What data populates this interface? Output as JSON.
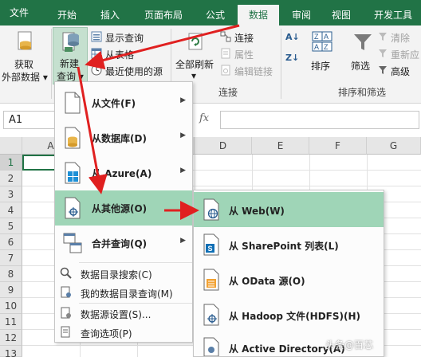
{
  "tabs": [
    {
      "label": "文件",
      "active": false
    },
    {
      "label": "开始",
      "active": false
    },
    {
      "label": "插入",
      "active": false
    },
    {
      "label": "页面布局",
      "active": false
    },
    {
      "label": "公式",
      "active": false
    },
    {
      "label": "数据",
      "active": true
    },
    {
      "label": "审阅",
      "active": false
    },
    {
      "label": "视图",
      "active": false
    },
    {
      "label": "开发工具",
      "active": false
    }
  ],
  "ribbon": {
    "get_external_data": [
      "获取",
      "外部数据 ▾"
    ],
    "new_query": [
      "新建",
      "查询 ▾"
    ],
    "show_queries": "显示查询",
    "from_table": "从表格",
    "recent_sources": "最近使用的源",
    "refresh_all": "全部刷新",
    "connections": "连接",
    "properties": "属性",
    "edit_links": "编辑链接",
    "group_connections": "连接",
    "sort": "排序",
    "filter": "筛选",
    "clear": "清除",
    "reapply": "重新应",
    "advanced": "高级",
    "group_sort_filter": "排序和筛选"
  },
  "formula_bar": {
    "name_box": "A1",
    "fx": "fx"
  },
  "grid": {
    "columns": [
      "A",
      "B",
      "C",
      "D",
      "E",
      "F",
      "G"
    ],
    "rows": [
      "1",
      "2",
      "3",
      "4",
      "5",
      "6",
      "7",
      "8",
      "9",
      "10",
      "11",
      "12",
      "13"
    ]
  },
  "menu_new_query": {
    "items": [
      {
        "label": "从文件(F)",
        "icon": "file-icon"
      },
      {
        "label": "从数据库(D)",
        "icon": "database-icon"
      },
      {
        "label": "从 Azure(A)",
        "icon": "azure-icon"
      },
      {
        "label": "从其他源(O)",
        "icon": "other-source-icon"
      },
      {
        "label": "合并查询(Q)",
        "icon": "combine-icon"
      }
    ],
    "small_items": [
      {
        "label": "数据目录搜索(C)",
        "icon": "catalog-search-icon"
      },
      {
        "label": "我的数据目录查询(M)",
        "icon": "my-catalog-icon"
      },
      {
        "label": "数据源设置(S)...",
        "icon": "source-settings-icon"
      },
      {
        "label": "查询选项(P)",
        "icon": "query-options-icon"
      }
    ]
  },
  "menu_other_sources": {
    "items": [
      {
        "label": "从 Web(W)",
        "icon": "web-icon"
      },
      {
        "label": "从 SharePoint 列表(L)",
        "icon": "sharepoint-icon"
      },
      {
        "label": "从 OData 源(O)",
        "icon": "odata-icon"
      },
      {
        "label": "从 Hadoop 文件(HDFS)(H)",
        "icon": "hadoop-icon"
      },
      {
        "label": "从 Active Directory(A)",
        "icon": "active-directory-icon"
      }
    ]
  },
  "watermark": "头条@百芯",
  "colors": {
    "excel_green": "#217346",
    "highlight": "#9fd5b7",
    "arrow_red": "#e02020"
  }
}
